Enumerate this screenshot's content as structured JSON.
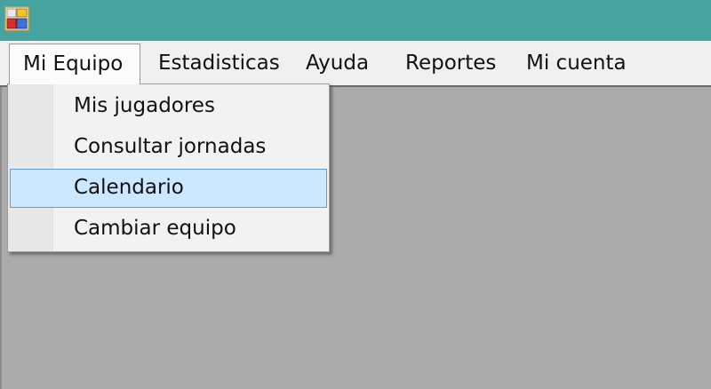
{
  "menubar": {
    "items": [
      {
        "label": "Mi Equipo",
        "open": true
      },
      {
        "label": "Estadisticas"
      },
      {
        "label": "Ayuda"
      },
      {
        "label": "Reportes"
      },
      {
        "label": "Mi cuenta"
      }
    ]
  },
  "dropdown": {
    "items": [
      {
        "label": "Mis jugadores"
      },
      {
        "label": "Consultar jornadas"
      },
      {
        "label": "Calendario",
        "highlighted": true
      },
      {
        "label": "Cambiar equipo"
      }
    ]
  },
  "colors": {
    "titlebar": "#46a3a0",
    "menubar": "#f0f0f0",
    "client_area": "#ababab",
    "highlight": "#cce8ff",
    "highlight_border": "#5aa0d8"
  },
  "icons": {
    "app": "app-icon"
  }
}
